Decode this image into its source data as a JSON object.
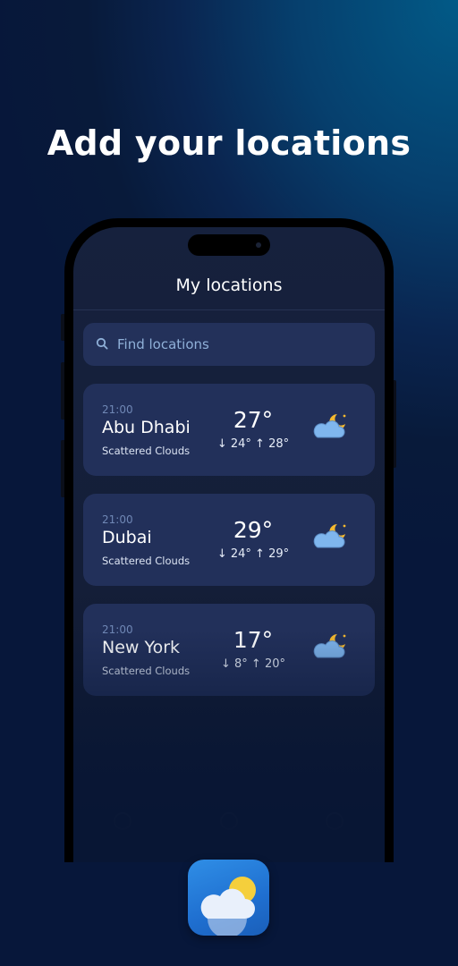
{
  "headline": "Add your locations",
  "screen": {
    "title": "My locations",
    "search": {
      "placeholder": "Find locations",
      "icon": "search-icon"
    },
    "locations": [
      {
        "time": "21:00",
        "city": "Abu Dhabi",
        "condition": "Scattered Clouds",
        "temp": "27°",
        "low": "24°",
        "high": "28°",
        "icon": "cloud-moon-icon"
      },
      {
        "time": "21:00",
        "city": "Dubai",
        "condition": "Scattered Clouds",
        "temp": "29°",
        "low": "24°",
        "high": "29°",
        "icon": "cloud-moon-icon"
      },
      {
        "time": "21:00",
        "city": "New York",
        "condition": "Scattered Clouds",
        "temp": "17°",
        "low": "8°",
        "high": "20°",
        "icon": "cloud-moon-icon"
      }
    ]
  },
  "app_icon": "cloud-sun-app-icon",
  "colors": {
    "card": "#22305a",
    "search": "#23315a",
    "accent_sun": "#f5b92e",
    "cloud": "#7fb6ee"
  }
}
